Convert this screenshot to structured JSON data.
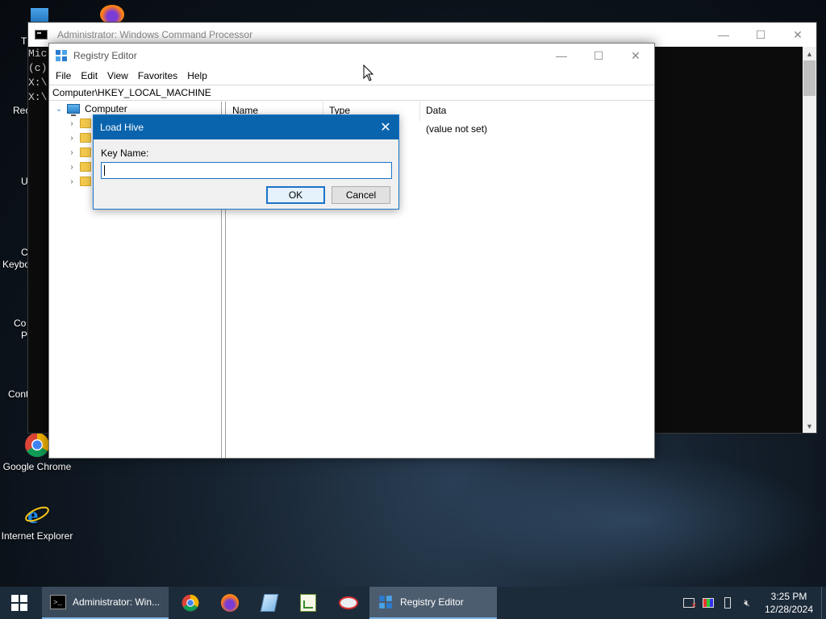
{
  "desktop": {
    "icons": [
      {
        "label": "Google Chrome",
        "icon": "chrome-icon"
      },
      {
        "label": "Internet Explorer",
        "icon": "internet-explorer-icon"
      }
    ],
    "partial_labels": [
      "T",
      "Rec",
      "U",
      "C",
      "Keybo",
      "Co",
      "P",
      "Cont"
    ]
  },
  "cmd_window": {
    "title": "Administrator: Windows Command Processor",
    "lines": [
      "Mic",
      "(c)",
      "",
      "X:\\",
      "X:\\"
    ],
    "controls": {
      "minimize": "—",
      "maximize": "☐",
      "close": "✕"
    }
  },
  "registry_editor": {
    "title": "Registry Editor",
    "menu": [
      "File",
      "Edit",
      "View",
      "Favorites",
      "Help"
    ],
    "address": "Computer\\HKEY_LOCAL_MACHINE",
    "tree": {
      "root": "Computer",
      "child_count": 5
    },
    "columns": [
      "Name",
      "Type",
      "Data"
    ],
    "rows": [
      {
        "data": "(value not set)"
      }
    ],
    "controls": {
      "minimize": "—",
      "maximize": "☐",
      "close": "✕"
    }
  },
  "load_hive_dialog": {
    "title": "Load Hive",
    "label": "Key Name:",
    "value": "",
    "ok_label": "OK",
    "cancel_label": "Cancel",
    "close": "✕"
  },
  "taskbar": {
    "tasks": [
      {
        "label": "Administrator: Win...",
        "icon": "cmd-icon"
      },
      {
        "label": "Registry Editor",
        "icon": "regedit-icon"
      }
    ],
    "pinned": [
      "chrome-icon",
      "firefox-icon",
      "notepad-icon",
      "spreadsheet-icon",
      "paint-icon"
    ],
    "clock": {
      "time": "3:25 PM",
      "date": "12/28/2024"
    }
  },
  "colors": {
    "dialog_title_bg": "#0a64ad",
    "taskbar_bg": "#1c2b3a",
    "accent": "#1a73c8"
  }
}
